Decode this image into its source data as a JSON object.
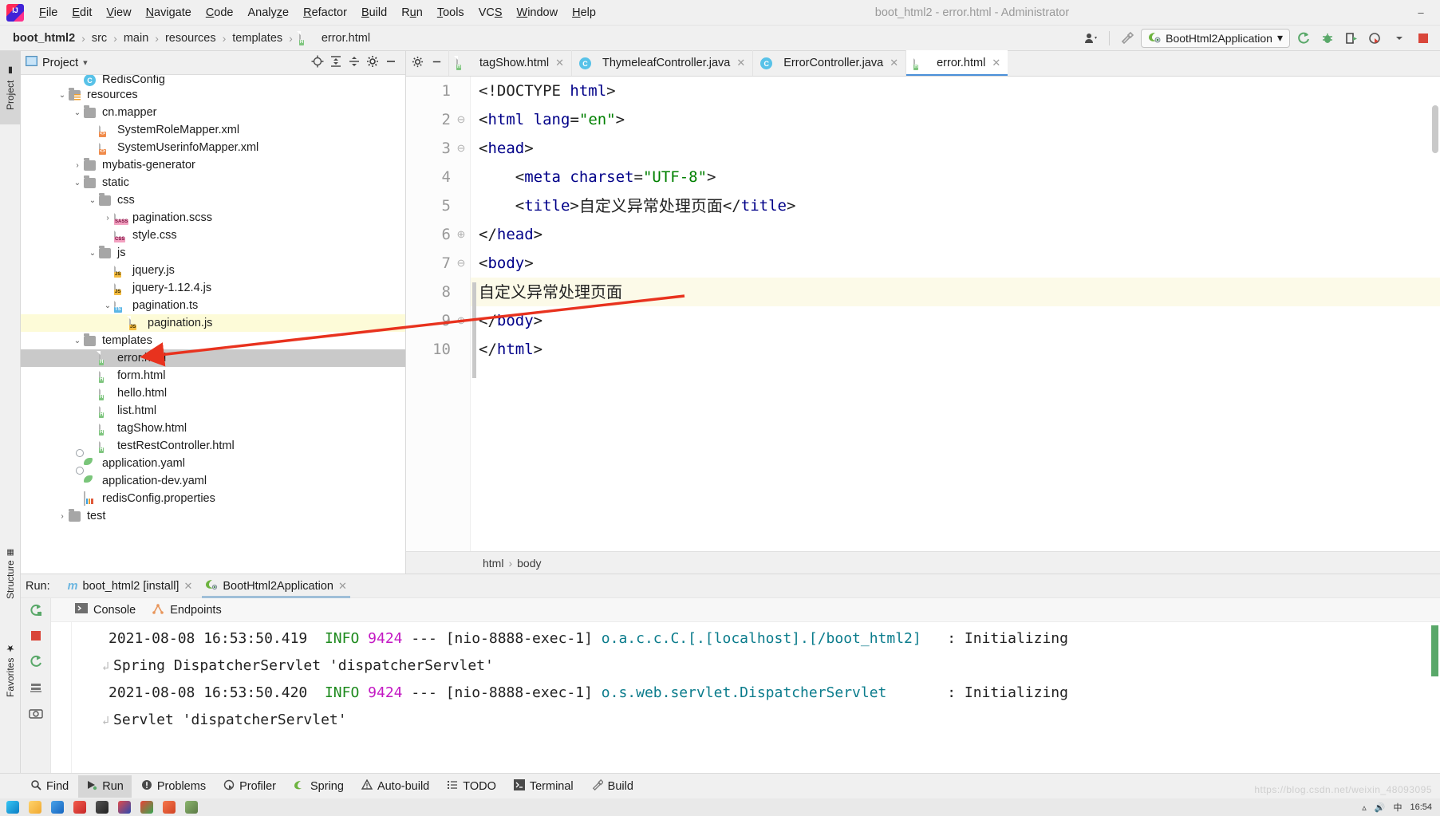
{
  "window": {
    "title": "boot_html2 - error.html - Administrator",
    "minimize": "–",
    "maximize": "□",
    "close": "✕"
  },
  "menu": [
    {
      "label": "File",
      "mnemonic": "F"
    },
    {
      "label": "Edit",
      "mnemonic": "E"
    },
    {
      "label": "View",
      "mnemonic": "V"
    },
    {
      "label": "Navigate",
      "mnemonic": "N"
    },
    {
      "label": "Code",
      "mnemonic": "C"
    },
    {
      "label": "Analyze",
      "mnemonic": "z"
    },
    {
      "label": "Refactor",
      "mnemonic": "R"
    },
    {
      "label": "Build",
      "mnemonic": "B"
    },
    {
      "label": "Run",
      "mnemonic": "u"
    },
    {
      "label": "Tools",
      "mnemonic": "T"
    },
    {
      "label": "VCS",
      "mnemonic": "S"
    },
    {
      "label": "Window",
      "mnemonic": "W"
    },
    {
      "label": "Help",
      "mnemonic": "H"
    }
  ],
  "breadcrumb": {
    "items": [
      "boot_html2",
      "src",
      "main",
      "resources",
      "templates"
    ],
    "file": "error.html",
    "separator": "›"
  },
  "toolbar": {
    "run_config": "BootHtml2Application",
    "dropdown_caret": "▾",
    "icons": {
      "user": "user-settings-icon",
      "hammer": "build-icon",
      "rerun": "rerun-icon",
      "debug": "debug-icon",
      "run_coverage": "run-with-coverage-icon",
      "profiler": "profiler-icon",
      "stop": "stop-icon"
    }
  },
  "tool_strip": {
    "left": [
      {
        "label": "Project",
        "active": true
      },
      {
        "label": "Structure",
        "active": false
      },
      {
        "label": "Favorites",
        "active": false
      }
    ]
  },
  "project_panel": {
    "title": "Project",
    "caret": "▾",
    "actions": [
      "locate-icon",
      "expand-all-icon",
      "collapse-all-icon",
      "settings-icon",
      "hide-icon"
    ],
    "tree": [
      {
        "indent": 3,
        "twisty": "",
        "icon": "class",
        "badge": "C",
        "label": "RedisConfig",
        "state": "clipped"
      },
      {
        "indent": 2,
        "twisty": "⌄",
        "icon": "folder-resources",
        "label": "resources",
        "state": "normal"
      },
      {
        "indent": 3,
        "twisty": "⌄",
        "icon": "folder",
        "label": "cn.mapper",
        "state": "normal"
      },
      {
        "indent": 4,
        "twisty": "",
        "icon": "file-xml",
        "badge": "<>",
        "label": "SystemRoleMapper.xml",
        "state": "normal"
      },
      {
        "indent": 4,
        "twisty": "",
        "icon": "file-xml",
        "badge": "<>",
        "label": "SystemUserinfoMapper.xml",
        "state": "normal"
      },
      {
        "indent": 3,
        "twisty": "›",
        "icon": "folder",
        "label": "mybatis-generator",
        "state": "normal"
      },
      {
        "indent": 3,
        "twisty": "⌄",
        "icon": "folder",
        "label": "static",
        "state": "normal"
      },
      {
        "indent": 4,
        "twisty": "⌄",
        "icon": "folder",
        "label": "css",
        "state": "normal"
      },
      {
        "indent": 5,
        "twisty": "›",
        "icon": "file-sass",
        "badge": "SASS",
        "label": "pagination.scss",
        "state": "normal"
      },
      {
        "indent": 5,
        "twisty": "",
        "icon": "file-css",
        "badge": "CSS",
        "label": "style.css",
        "state": "normal"
      },
      {
        "indent": 4,
        "twisty": "⌄",
        "icon": "folder",
        "label": "js",
        "state": "normal"
      },
      {
        "indent": 5,
        "twisty": "",
        "icon": "file-js-min",
        "badge": "JS",
        "label": "jquery.js",
        "state": "normal"
      },
      {
        "indent": 5,
        "twisty": "",
        "icon": "file-js",
        "badge": "JS",
        "label": "jquery-1.12.4.js",
        "state": "normal"
      },
      {
        "indent": 5,
        "twisty": "⌄",
        "icon": "file-ts",
        "badge": "TS",
        "label": "pagination.ts",
        "state": "normal"
      },
      {
        "indent": 6,
        "twisty": "",
        "icon": "file-js",
        "badge": "JS",
        "label": "pagination.js",
        "state": "highlight"
      },
      {
        "indent": 3,
        "twisty": "⌄",
        "icon": "folder",
        "label": "templates",
        "state": "normal"
      },
      {
        "indent": 4,
        "twisty": "",
        "icon": "file-html",
        "badge": "H",
        "label": "error.html",
        "state": "selected"
      },
      {
        "indent": 4,
        "twisty": "",
        "icon": "file-html",
        "badge": "H",
        "label": "form.html",
        "state": "normal"
      },
      {
        "indent": 4,
        "twisty": "",
        "icon": "file-html",
        "badge": "H",
        "label": "hello.html",
        "state": "normal"
      },
      {
        "indent": 4,
        "twisty": "",
        "icon": "file-html",
        "badge": "H",
        "label": "list.html",
        "state": "normal"
      },
      {
        "indent": 4,
        "twisty": "",
        "icon": "file-html",
        "badge": "H",
        "label": "tagShow.html",
        "state": "normal"
      },
      {
        "indent": 4,
        "twisty": "",
        "icon": "file-html",
        "badge": "H",
        "label": "testRestController.html",
        "state": "normal"
      },
      {
        "indent": 3,
        "twisty": "",
        "icon": "file-yaml",
        "label": "application.yaml",
        "state": "normal"
      },
      {
        "indent": 3,
        "twisty": "",
        "icon": "file-yaml",
        "label": "application-dev.yaml",
        "state": "normal"
      },
      {
        "indent": 3,
        "twisty": "",
        "icon": "file-props",
        "label": "redisConfig.properties",
        "state": "normal"
      },
      {
        "indent": 2,
        "twisty": "›",
        "icon": "folder",
        "label": "test",
        "state": "normal"
      }
    ]
  },
  "editor": {
    "tabs": [
      {
        "label": "tagShow.html",
        "icon": "file-html",
        "badge": "H",
        "active": false,
        "close": "✕"
      },
      {
        "label": "ThymeleafController.java",
        "icon": "class",
        "badge": "C",
        "active": false,
        "close": "✕"
      },
      {
        "label": "ErrorController.java",
        "icon": "class",
        "badge": "C",
        "active": false,
        "close": "✕"
      },
      {
        "label": "error.html",
        "icon": "file-html",
        "badge": "H",
        "active": true,
        "close": "✕"
      }
    ],
    "tools": [
      "settings-icon",
      "hide-icon"
    ],
    "lines": [
      {
        "n": "1",
        "fold": "",
        "highlight": false,
        "tokens": [
          {
            "t": "punc",
            "v": "<!DOCTYPE "
          },
          {
            "t": "tag",
            "v": "html"
          },
          {
            "t": "punc",
            "v": ">"
          }
        ]
      },
      {
        "n": "2",
        "fold": "⊖",
        "highlight": false,
        "tokens": [
          {
            "t": "punc",
            "v": "<"
          },
          {
            "t": "tag",
            "v": "html"
          },
          {
            "t": "punc",
            "v": " "
          },
          {
            "t": "tag",
            "v": "lang"
          },
          {
            "t": "punc",
            "v": "="
          },
          {
            "t": "str",
            "v": "\"en\""
          },
          {
            "t": "punc",
            "v": ">"
          }
        ]
      },
      {
        "n": "3",
        "fold": "⊖",
        "highlight": false,
        "tokens": [
          {
            "t": "punc",
            "v": "<"
          },
          {
            "t": "tag",
            "v": "head"
          },
          {
            "t": "punc",
            "v": ">"
          }
        ]
      },
      {
        "n": "4",
        "fold": "",
        "highlight": false,
        "tokens": [
          {
            "t": "punc",
            "v": "    <"
          },
          {
            "t": "tag",
            "v": "meta"
          },
          {
            "t": "punc",
            "v": " "
          },
          {
            "t": "tag",
            "v": "charset"
          },
          {
            "t": "punc",
            "v": "="
          },
          {
            "t": "str",
            "v": "\"UTF-8\""
          },
          {
            "t": "punc",
            "v": ">"
          }
        ]
      },
      {
        "n": "5",
        "fold": "",
        "highlight": false,
        "tokens": [
          {
            "t": "punc",
            "v": "    <"
          },
          {
            "t": "tag",
            "v": "title"
          },
          {
            "t": "punc",
            "v": ">"
          },
          {
            "t": "txt",
            "v": "自定义异常处理页面"
          },
          {
            "t": "punc",
            "v": "</"
          },
          {
            "t": "tag",
            "v": "title"
          },
          {
            "t": "punc",
            "v": ">"
          }
        ]
      },
      {
        "n": "6",
        "fold": "⊕",
        "highlight": false,
        "tokens": [
          {
            "t": "punc",
            "v": "</"
          },
          {
            "t": "tag",
            "v": "head"
          },
          {
            "t": "punc",
            "v": ">"
          }
        ]
      },
      {
        "n": "7",
        "fold": "⊖",
        "highlight": false,
        "tokens": [
          {
            "t": "punc",
            "v": "<"
          },
          {
            "t": "tag",
            "v": "body"
          },
          {
            "t": "punc",
            "v": ">"
          }
        ]
      },
      {
        "n": "8",
        "fold": "",
        "highlight": true,
        "tokens": [
          {
            "t": "txt",
            "v": "自定义异常处理页面"
          }
        ]
      },
      {
        "n": "9",
        "fold": "⊕",
        "highlight": false,
        "tokens": [
          {
            "t": "punc",
            "v": "</"
          },
          {
            "t": "tag",
            "v": "body"
          },
          {
            "t": "punc",
            "v": ">"
          }
        ]
      },
      {
        "n": "10",
        "fold": "",
        "highlight": false,
        "tokens": [
          {
            "t": "punc",
            "v": "</"
          },
          {
            "t": "tag",
            "v": "html"
          },
          {
            "t": "punc",
            "v": ">"
          }
        ]
      }
    ],
    "breadcrumb": [
      "html",
      "body"
    ],
    "breadcrumb_sep": "›"
  },
  "run_window": {
    "label": "Run:",
    "tabs": [
      {
        "label": "boot_html2 [install]",
        "icon": "maven-icon",
        "active": false,
        "close": "✕"
      },
      {
        "label": "BootHtml2Application",
        "icon": "spring-icon",
        "active": true,
        "close": "✕"
      }
    ],
    "subtabs": [
      {
        "label": "Console",
        "icon": "console-icon"
      },
      {
        "label": "Endpoints",
        "icon": "endpoints-icon"
      }
    ],
    "side_icons": [
      "rerun-icon",
      "stop-icon",
      "restart-icon",
      "camera-icon"
    ],
    "console_lines": [
      {
        "type": "log",
        "date": "2021-08-08 16:53:50.419",
        "level": "INFO",
        "pid": "9424",
        "dashes": "---",
        "thread": "[nio-8888-exec-1]",
        "logger": "o.a.c.c.C.[.[localhost].[/boot_html2]",
        "colon": ":",
        "message": "Initializing"
      },
      {
        "type": "wrap",
        "message": "Spring DispatcherServlet 'dispatcherServlet'"
      },
      {
        "type": "log",
        "date": "2021-08-08 16:53:50.420",
        "level": "INFO",
        "pid": "9424",
        "dashes": "---",
        "thread": "[nio-8888-exec-1]",
        "logger": "o.s.web.servlet.DispatcherServlet",
        "colon": ":",
        "message": "Initializing"
      },
      {
        "type": "wrap",
        "message": "Servlet 'dispatcherServlet'"
      }
    ]
  },
  "status_bar": {
    "buttons": [
      {
        "label": "Find",
        "icon": "search-icon",
        "active": false
      },
      {
        "label": "Run",
        "icon": "run-icon",
        "active": true
      },
      {
        "label": "Problems",
        "icon": "problems-icon",
        "active": false
      },
      {
        "label": "Profiler",
        "icon": "profiler-icon",
        "active": false
      },
      {
        "label": "Spring",
        "icon": "spring-icon",
        "active": false
      },
      {
        "label": "Auto-build",
        "icon": "warning-icon",
        "active": false
      },
      {
        "label": "TODO",
        "icon": "todo-icon",
        "active": false
      },
      {
        "label": "Terminal",
        "icon": "terminal-icon",
        "active": false
      },
      {
        "label": "Build",
        "icon": "hammer-icon",
        "active": false
      }
    ],
    "watermark": "https://blog.csdn.net/weixin_48093095"
  },
  "taskbar": {
    "clock": "16:54",
    "apps": [
      "edge-icon",
      "explorer-icon",
      "onedrive-icon",
      "app-red-icon",
      "bag-icon",
      "office-icon",
      "chrome-icon",
      "ppt-icon",
      "avatar-icon"
    ],
    "tray": [
      "network-icon",
      "volume-icon",
      "ime-icon"
    ]
  },
  "colors": {
    "accent_blue": "#4a90d9",
    "selection_gray": "#c9c9c9",
    "highlight_yellow": "#fcfae8",
    "annotation_red": "#e8321e",
    "tag_blue": "#000088",
    "string_green": "#008000",
    "log_info_green": "#1d8a1d",
    "log_pid_magenta": "#c318c3",
    "log_logger_teal": "#0b7c8c"
  }
}
